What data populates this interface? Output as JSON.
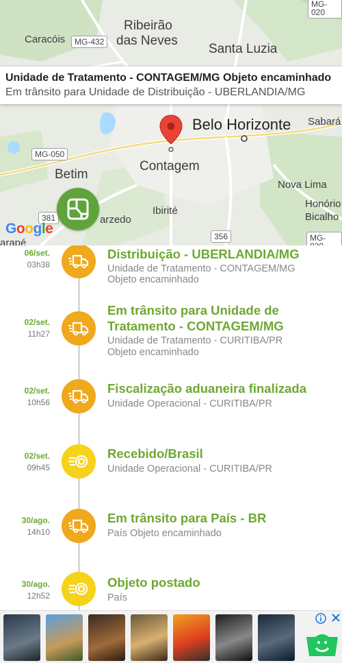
{
  "map": {
    "places": {
      "caracois": "Caracóis",
      "ribeirao": "Ribeirão",
      "das_neves": "das Neves",
      "santa_luzia": "Santa Luzia",
      "belo_horizonte": "Belo Horizonte",
      "sabara": "Sabará",
      "contagem": "Contagem",
      "betim": "Betim",
      "nova_lima": "Nova Lima",
      "ibirite": "Ibirité",
      "sarzedo": "arzedo",
      "honorio": "Honório",
      "bicalho": "Bicalho",
      "sarape": "arapé"
    },
    "roads": {
      "mg432": "MG-432",
      "mg050": "MG-050",
      "r381": "381",
      "r356": "356",
      "mg030": "MG-030",
      "mg020": "MG-020"
    },
    "info_window": {
      "title": "Unidade de Tratamento - CONTAGEM/MG Objeto encaminhado",
      "subtitle": "Em trânsito para Unidade de Distribuição - UBERLANDIA/MG"
    },
    "google_logo": [
      "G",
      "o",
      "o",
      "g",
      "l",
      "e"
    ]
  },
  "timeline": [
    {
      "date": "06/set.",
      "time": "03h38",
      "icon": "truck-icon",
      "title": "Distribuição - UBERLANDIA/MG",
      "sub1": "Unidade de Tratamento - CONTAGEM/MG",
      "sub2": "Objeto encaminhado"
    },
    {
      "date": "02/set.",
      "time": "11h27",
      "icon": "truck-icon",
      "title": "Em trânsito para Unidade de Tratamento - CONTAGEM/MG",
      "sub1": "Unidade de Tratamento - CURITIBA/PR",
      "sub2": "Objeto encaminhado"
    },
    {
      "date": "02/set.",
      "time": "10h56",
      "icon": "truck-icon",
      "title": "Fiscalização aduaneira finalizada",
      "sub1": "Unidade Operacional - CURITIBA/PR",
      "sub2": ""
    },
    {
      "date": "02/set.",
      "time": "09h45",
      "icon": "received-icon",
      "title": "Recebido/Brasil",
      "sub1": "Unidade Operacional - CURITIBA/PR",
      "sub2": ""
    },
    {
      "date": "30/ago.",
      "time": "14h10",
      "icon": "truck-icon",
      "title": "Em trânsito para País - BR",
      "sub1": "País Objeto encaminhado",
      "sub2": ""
    },
    {
      "date": "30/ago.",
      "time": "12h52",
      "icon": "posted-icon",
      "title": "Objeto postado",
      "sub1": "País",
      "sub2": ""
    }
  ],
  "colors": {
    "accent_green": "#6ea832",
    "truck_orange": "#f0a81d",
    "received_yellow": "#f7d21a",
    "map_button": "#5fa33b"
  },
  "ads": {
    "thumbs": [
      "ac-valhalla-cover",
      "immortals-fenyx-rising-cover",
      "last-of-us-cover",
      "ac-origins-cover",
      "hot-wheels-cover",
      "ac-brotherhood-cover",
      "ac-rogue-cover"
    ]
  }
}
